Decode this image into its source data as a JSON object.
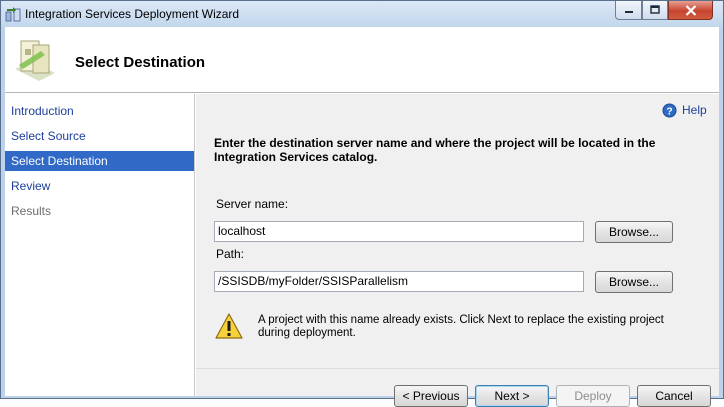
{
  "window": {
    "title": "Integration Services Deployment Wizard",
    "icon": "ssis-deploy-icon"
  },
  "header": {
    "title": "Select Destination",
    "icon": "wizard-destination-icon"
  },
  "sidebar": {
    "items": [
      {
        "label": "Introduction",
        "state": "link"
      },
      {
        "label": "Select Source",
        "state": "link"
      },
      {
        "label": "Select Destination",
        "state": "selected"
      },
      {
        "label": "Review",
        "state": "link"
      },
      {
        "label": "Results",
        "state": "disabled"
      }
    ]
  },
  "content": {
    "help_label": "Help",
    "instructions": "Enter the destination server name and where the project will be located in the Integration Services catalog.",
    "server": {
      "label": "Server name:",
      "value": "localhost",
      "browse_label": "Browse..."
    },
    "path": {
      "label": "Path:",
      "value": "/SSISDB/myFolder/SSISParallelism",
      "browse_label": "Browse..."
    },
    "warning": {
      "icon": "warning-icon",
      "text": "A project with this name already exists. Click Next to replace the existing project during deployment."
    }
  },
  "footer": {
    "previous_label": "< Previous",
    "next_label": "Next >",
    "deploy_label": "Deploy",
    "cancel_label": "Cancel"
  },
  "colors": {
    "selection": "#3069c6",
    "link": "#1c3f9c",
    "frame": "#bcd2ea"
  }
}
